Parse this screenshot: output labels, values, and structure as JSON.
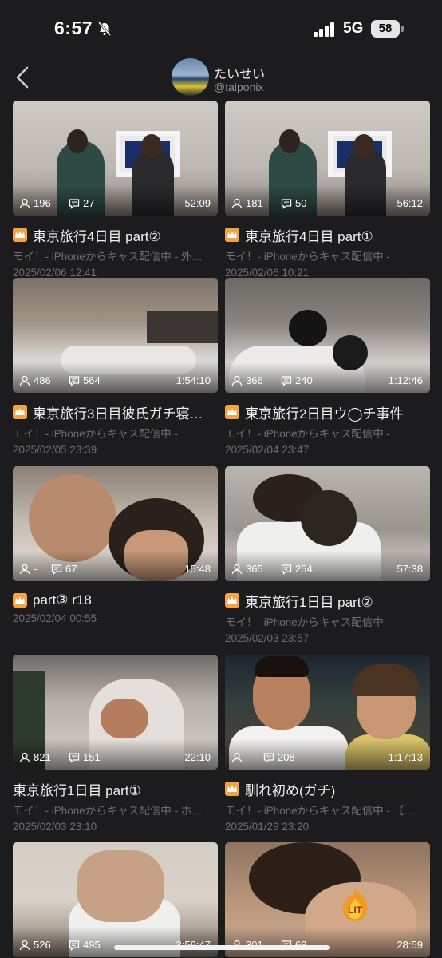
{
  "status_bar": {
    "time": "6:57",
    "network": "5G",
    "battery": "58"
  },
  "header": {
    "name": "たいせい",
    "handle": "@taiponix"
  },
  "videos": [
    {
      "viewers": "196",
      "comments": "27",
      "duration": "52:09",
      "title": "東京旅行4日目 part②",
      "description": "モイ！- iPhoneからキャス配信中 - 外…",
      "date": "2025/02/06 12:41",
      "crown": true
    },
    {
      "viewers": "181",
      "comments": "50",
      "duration": "56:12",
      "title": "東京旅行4日目 part①",
      "description": "モイ！- iPhoneからキャス配信中 -",
      "date": "2025/02/06 10:21",
      "crown": true
    },
    {
      "viewers": "486",
      "comments": "564",
      "duration": "1:54:10",
      "title": "東京旅行3日目彼氏ガチ寝…",
      "description": "モイ！- iPhoneからキャス配信中 -",
      "date": "2025/02/05 23:39",
      "crown": true
    },
    {
      "viewers": "366",
      "comments": "240",
      "duration": "1:12:46",
      "title": "東京旅行2日目ウ◯チ事件",
      "description": "モイ！- iPhoneからキャス配信中 -",
      "date": "2025/02/04 23:47",
      "crown": true
    },
    {
      "viewers": "-",
      "comments": "67",
      "duration": "15:48",
      "title": "part③ r18",
      "description": "",
      "date": "2025/02/04 00:55",
      "crown": true
    },
    {
      "viewers": "365",
      "comments": "254",
      "duration": "57:38",
      "title": "東京旅行1日目 part②",
      "description": "モイ！- iPhoneからキャス配信中 -",
      "date": "2025/02/03 23:57",
      "crown": true
    },
    {
      "viewers": "821",
      "comments": "151",
      "duration": "22:10",
      "title": "東京旅行1日目 part①",
      "description": "モイ！- iPhoneからキャス配信中 - ホ…",
      "date": "2025/02/03 23:10",
      "crown": false
    },
    {
      "viewers": "-",
      "comments": "208",
      "duration": "1:17:13",
      "title": "馴れ初め(ガチ)",
      "description": "モイ！- iPhoneからキャス配信中 - 【…",
      "date": "2025/01/29 23:20",
      "crown": true
    },
    {
      "viewers": "526",
      "comments": "495",
      "duration": "3:59:47",
      "title": "",
      "description": "",
      "date": "",
      "crown": false
    },
    {
      "viewers": "301",
      "comments": "68",
      "duration": "28:59",
      "title": "",
      "description": "",
      "date": "",
      "crown": false
    }
  ],
  "badges": {
    "lit": "LIT"
  },
  "colors": {
    "background": "#1c1c1e",
    "crown": "#f4a340",
    "meta_text": "#6e6e73"
  }
}
